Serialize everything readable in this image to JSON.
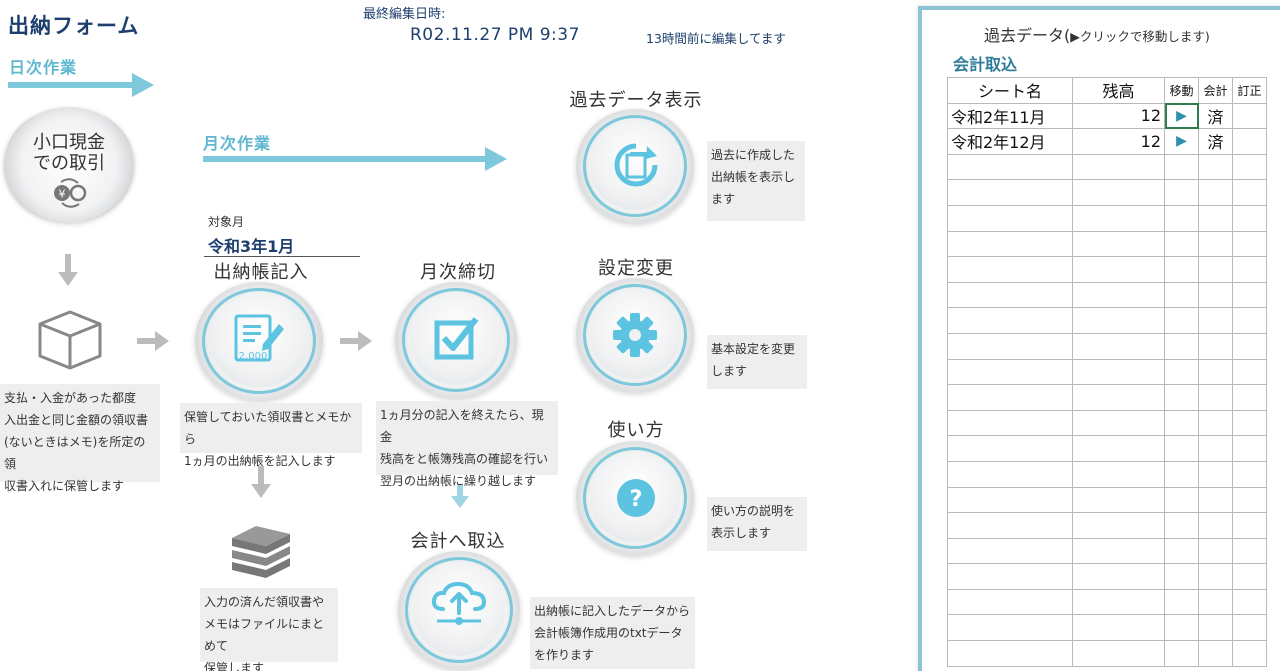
{
  "header": {
    "title": "出納フォーム",
    "last_edit_label": "最終編集日時:",
    "last_edit_value": "R02.11.27  PM 9:37",
    "last_edit_ago": "13時間前に編集してます"
  },
  "daily": {
    "label": "日次作業"
  },
  "monthly": {
    "label": "月次作業"
  },
  "petty_cash": {
    "line1": "小口現金",
    "line2": "での取引",
    "icon": "yen-exchange-icon",
    "desc": [
      "支払・入金があった都度",
      "入出金と同じ金額の領収書",
      "(ないときはメモ)を所定の領",
      "収書入れに保管します"
    ]
  },
  "target_month": {
    "label": "対象月",
    "value": "令和3年1月"
  },
  "ledger": {
    "title": "出納帳記入",
    "icon": "document-edit-icon",
    "icon_text": "2,000",
    "desc": [
      "保管しておいた領収書とメモから",
      "1ヵ月の出納帳を記入します"
    ]
  },
  "monthly_close": {
    "title": "月次締切",
    "icon": "checkbox-icon",
    "desc": [
      "1ヵ月分の記入を終えたら、現金",
      "残高をと帳簿残高の確認を行い",
      "翌月の出納帳に繰り越します"
    ]
  },
  "archive": {
    "icon": "books-icon",
    "desc": [
      "入力の済んだ領収書や",
      "メモはファイルにまとめて",
      "保管します"
    ]
  },
  "accounting_import": {
    "title": "会計へ取込",
    "icon": "cloud-upload-icon",
    "desc": [
      "出納帳に記入したデータから",
      "会計帳簿作成用のtxtデータ",
      "を作ります"
    ]
  },
  "past_data": {
    "title": "過去データ表示",
    "icon": "history-icon",
    "desc": [
      "過去に作成した",
      "出納帳を表示し",
      "ます"
    ]
  },
  "settings": {
    "title": "設定変更",
    "icon": "gear-icon",
    "desc": [
      "基本設定を変更",
      "します"
    ]
  },
  "help": {
    "title": "使い方",
    "icon": "question-icon",
    "desc": [
      "使い方の説明を",
      "表示します"
    ]
  },
  "panel": {
    "title": "過去データ(",
    "title_hint": "▶クリックで移動します)",
    "subtitle": "会計取込",
    "columns": [
      "シート名",
      "残高",
      "移動",
      "会計",
      "訂正"
    ],
    "rows": [
      {
        "sheet": "令和2年11月",
        "balance": "12",
        "move": "▶",
        "account": "済",
        "fix": ""
      },
      {
        "sheet": "令和2年12月",
        "balance": "12",
        "move": "▶",
        "account": "済",
        "fix": ""
      }
    ],
    "empty_rows": 20
  },
  "colors": {
    "accent": "#7ec8dc",
    "title": "#1d3f6e",
    "icon": "#5cc3e0",
    "subtitle": "#2e7d9a"
  }
}
